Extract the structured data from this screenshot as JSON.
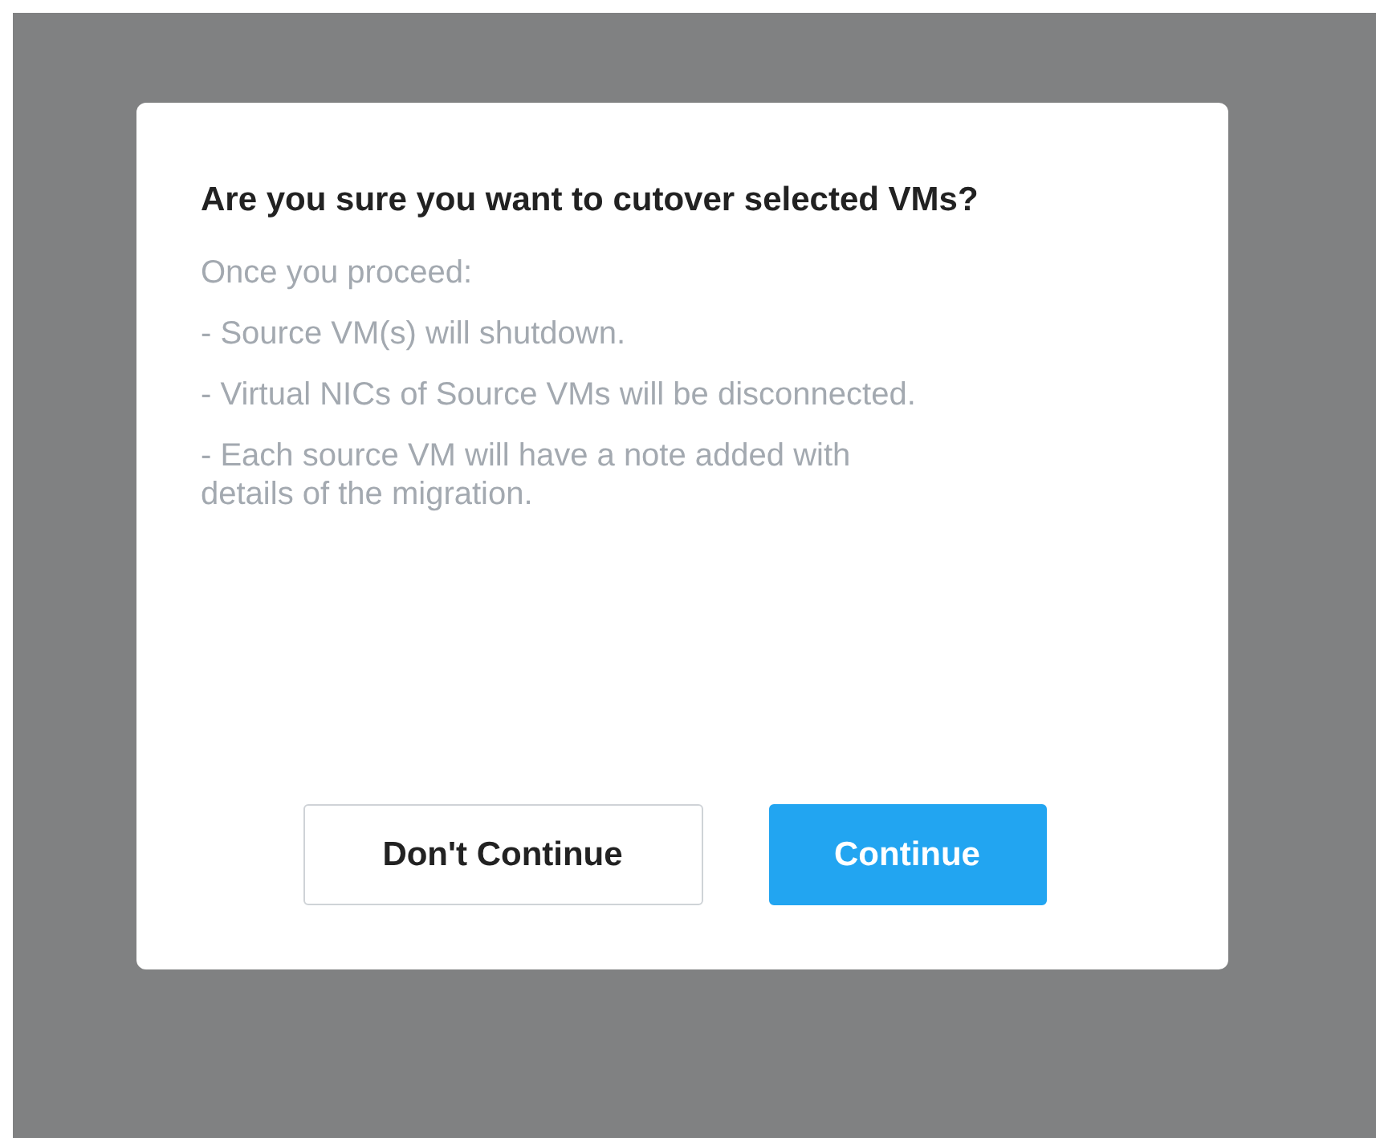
{
  "dialog": {
    "title": "Are you sure you want to cutover selected VMs?",
    "paragraphs": [
      "Once you proceed:",
      "- Source VM(s) will shutdown.",
      "- Virtual NICs of Source VMs will be disconnected.",
      "- Each source VM will have a note added with details of the migration."
    ],
    "buttons": [
      {
        "label": "Don't Continue",
        "kind": "secondary"
      },
      {
        "label": "Continue",
        "kind": "primary"
      }
    ]
  }
}
